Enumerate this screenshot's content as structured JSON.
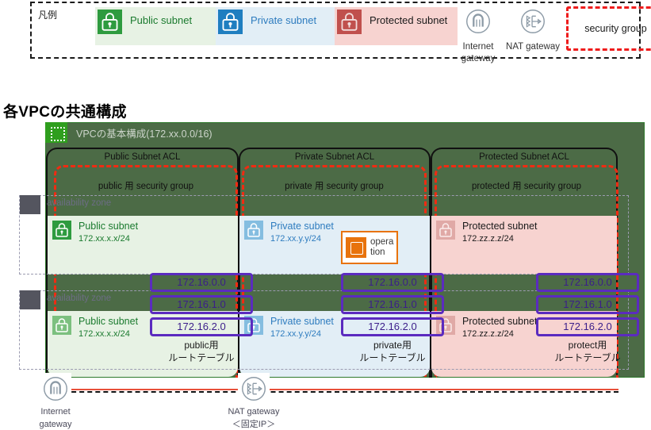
{
  "legend": {
    "title": "凡例",
    "items": [
      {
        "label": "Public subnet",
        "icon": "lock-icon"
      },
      {
        "label": "Private subnet",
        "icon": "lock-icon"
      },
      {
        "label": "Protected subnet",
        "icon": "lock-icon"
      }
    ],
    "gateways": [
      {
        "label": "Internet\ngateway",
        "line1": "Internet",
        "line2": "gateway",
        "icon": "internet-gateway-icon"
      },
      {
        "label": "NAT gateway",
        "line1": "NAT gateway",
        "line2": "",
        "icon": "nat-gateway-icon"
      }
    ],
    "security_group": "security group"
  },
  "page_title": "各VPCの共通構成",
  "vpc": {
    "title": "VPCの基本構成(172.xx.0.0/16)",
    "icon": "vpc-icon"
  },
  "acls": [
    {
      "title": "Public Subnet ACL"
    },
    {
      "title": "Private Subnet ACL"
    },
    {
      "title": "Protected Subnet ACL"
    }
  ],
  "security_groups": [
    {
      "title": "public 用 security group"
    },
    {
      "title": "private 用 security group"
    },
    {
      "title": "protected 用 security group"
    }
  ],
  "availability_zones": [
    {
      "label": "availability zone"
    },
    {
      "label": "availability zone"
    }
  ],
  "subnets": {
    "row1": [
      {
        "name": "Public subnet",
        "cidr": "172.xx.x.x/24",
        "type": "public"
      },
      {
        "name": "Private subnet",
        "cidr": "172.xx.y.y/24",
        "type": "private"
      },
      {
        "name": "Protected subnet",
        "cidr": "172.zz.z.z/24",
        "type": "protected"
      }
    ],
    "row2": [
      {
        "name": "Public subnet",
        "cidr": "172.xx.x.x/24",
        "type": "public"
      },
      {
        "name": "Private subnet",
        "cidr": "172.xx.y.y/24",
        "type": "private"
      },
      {
        "name": "Protected subnet",
        "cidr": "172.zz.z.z/24",
        "type": "protected"
      }
    ]
  },
  "operation": {
    "line1": "opera",
    "line2": "tion",
    "icon": "ec2-instance-icon"
  },
  "route_tables": [
    {
      "routes": [
        "172.16.0.0",
        "172.16.1.0",
        "172.16.2.0"
      ],
      "caption_line1": "public用",
      "caption_line2": "ルートテーブル"
    },
    {
      "routes": [
        "172.16.0.0",
        "172.16.1.0",
        "172.16.2.0"
      ],
      "caption_line1": "private用",
      "caption_line2": "ルートテーブル"
    },
    {
      "routes": [
        "172.16.0.0",
        "172.16.1.0",
        "172.16.2.0"
      ],
      "caption_line1": "protect用",
      "caption_line2": "ルートテーブル"
    }
  ],
  "bottom_gateways": [
    {
      "line1": "Internet",
      "line2": "gateway",
      "icon": "internet-gateway-icon"
    },
    {
      "line1": "NAT gateway",
      "line2": "＜固定IP＞",
      "icon": "nat-gateway-icon"
    }
  ],
  "colors": {
    "public_bg": "#e7f2e4",
    "private_bg": "#e2eef6",
    "protected_bg": "#f7d3d0",
    "public_accent": "#2e9b3f",
    "private_accent": "#1f7ec0",
    "protected_accent": "#c0504d",
    "security_group_border": "#f02b12",
    "route_chip_border": "#5b2bbf",
    "vpc_bg": "#4c6b46",
    "operation_accent": "#e8730c"
  }
}
